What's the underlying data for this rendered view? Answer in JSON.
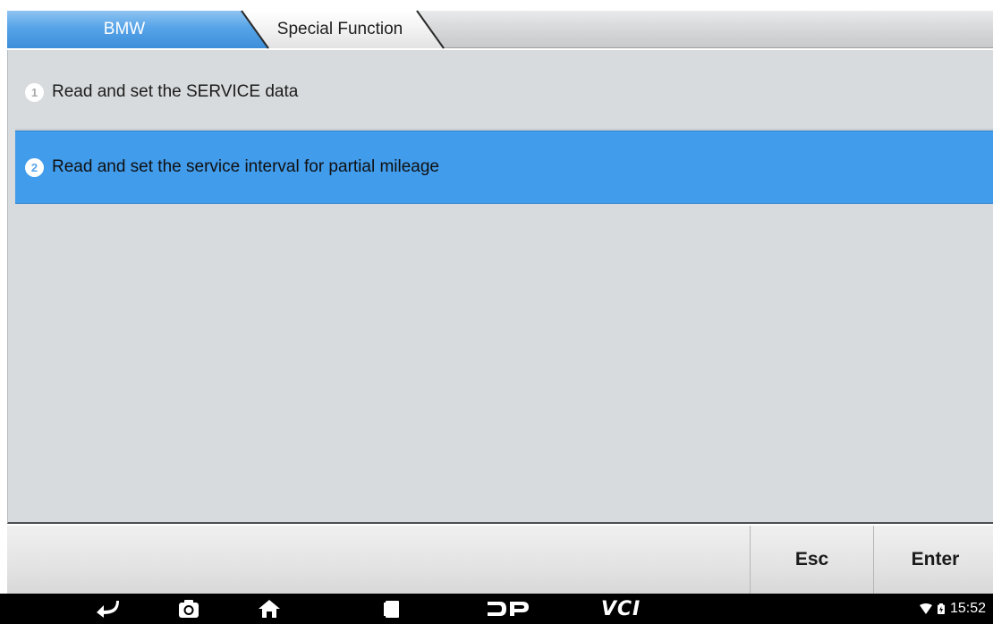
{
  "breadcrumb": {
    "items": [
      {
        "label": "BMW"
      },
      {
        "label": "Special Function"
      }
    ]
  },
  "menu": {
    "items": [
      {
        "number": "1",
        "label": "Read and set the SERVICE data",
        "selected": false
      },
      {
        "number": "2",
        "label": "Read and set the service interval for partial mileage",
        "selected": true
      }
    ]
  },
  "actions": {
    "esc_label": "Esc",
    "enter_label": "Enter"
  },
  "navbar": {
    "icons": [
      "back-icon",
      "camera-icon",
      "home-icon",
      "recent-apps-icon",
      "dp-icon",
      "vci-icon"
    ],
    "vci_label": "VCI"
  },
  "status": {
    "time": "15:52"
  },
  "colors": {
    "accent": "#419cec",
    "breadcrumb_active": "#56a3e8",
    "panel_bg": "#d8dbdd",
    "navbar_bg": "#000000"
  }
}
